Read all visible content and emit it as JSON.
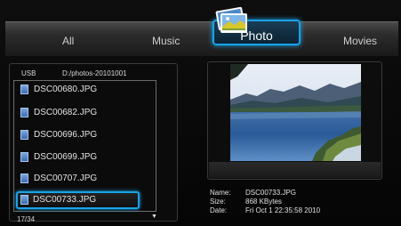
{
  "tabs": {
    "all": "All",
    "music": "Music",
    "photo": "Photo",
    "movies": "Movies"
  },
  "browser": {
    "source": "USB",
    "path": "D:/photos-20101001",
    "files": [
      "DSC00680.JPG",
      "DSC00682.JPG",
      "DSC00696.JPG",
      "DSC00699.JPG",
      "DSC00707.JPG",
      "DSC00733.JPG"
    ],
    "selected_file": "DSC00733.JPG",
    "counter": "17/34",
    "scroll_down": "▼"
  },
  "details": {
    "name_label": "Name:",
    "name_value": "DSC00733.JPG",
    "size_label": "Size:",
    "size_value": "868 KBytes",
    "date_label": "Date:",
    "date_value": "Fri Oct  1 22:35:58 2010"
  },
  "icons": {
    "photo_tab": "photo-landscape-icon",
    "file": "image-file-icon"
  },
  "colors": {
    "accent": "#1aa3e8",
    "background": "#070707"
  }
}
